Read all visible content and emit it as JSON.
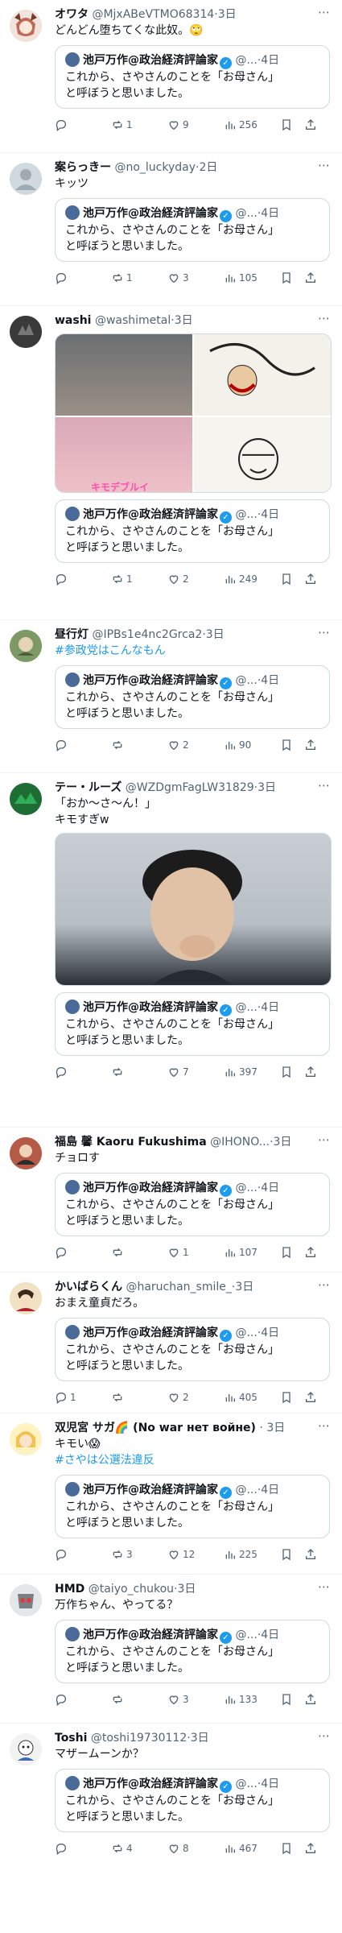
{
  "quoted": {
    "name": "池戸万作@政治経済評論家",
    "handle": "@...",
    "time": "4日",
    "text_line1": "これから、さやさんのことを「お母さん」",
    "text_line2": "と呼ぼうと思いました。"
  },
  "tweets": [
    {
      "name": "オワタ",
      "handle": "@MjxABeVTMO68314",
      "time": "3日",
      "line1": "どんどん堕ちてくな此奴。🙄",
      "line2": "",
      "replies": "",
      "retweets": "1",
      "likes": "9",
      "views": "256"
    },
    {
      "name": "案らっきー",
      "handle": "@no_luckyday",
      "time": "2日",
      "line1": "キッツ",
      "line2": "",
      "replies": "",
      "retweets": "1",
      "likes": "3",
      "views": "105"
    },
    {
      "name": "washi",
      "handle": "@washimetal",
      "time": "3日",
      "line1": "",
      "line2": "",
      "replies": "",
      "retweets": "1",
      "likes": "2",
      "views": "249",
      "media_caption": "キモデブルイ"
    },
    {
      "name": "昼行灯",
      "handle": "@IPBs1e4nc2Grca2",
      "time": "3日",
      "line1": "",
      "line1_tag": "#参政党はこんなもん",
      "line2": "",
      "replies": "",
      "retweets": "",
      "likes": "2",
      "views": "90"
    },
    {
      "name": "テー・ルーズ",
      "handle": "@WZDgmFagLW31829",
      "time": "3日",
      "line1": "「おか〜さ〜ん！」",
      "line2": "キモすぎw",
      "replies": "",
      "retweets": "",
      "likes": "7",
      "views": "397"
    },
    {
      "name": "福島 馨 Kaoru Fukushima",
      "handle": "@IHONO...",
      "time": "3日",
      "line1": "チョロす",
      "line2": "",
      "replies": "",
      "retweets": "",
      "likes": "1",
      "views": "107"
    },
    {
      "name": "かいばらくん",
      "handle": "@haruchan_smile_",
      "time": "3日",
      "line1": "おまえ童貞だろ。",
      "line2": "",
      "replies": "1",
      "retweets": "",
      "likes": "2",
      "views": "405"
    },
    {
      "name": "双児宮 サガ🌈 (No war нет войне)",
      "handle": "",
      "time": "3日",
      "line1": "キモい😱",
      "line2": "",
      "line2_tag": "#さやは公選法違反",
      "replies": "",
      "retweets": "3",
      "likes": "12",
      "views": "225"
    },
    {
      "name": "HMD",
      "handle": "@taiyo_chukou",
      "time": "3日",
      "line1": "万作ちゃん、やってる？",
      "line2": "",
      "replies": "",
      "retweets": "",
      "likes": "3",
      "views": "133"
    },
    {
      "name": "Toshi",
      "handle": "@toshi19730112",
      "time": "3日",
      "line1": "マザームーンか？",
      "line2": "",
      "replies": "",
      "retweets": "4",
      "likes": "8",
      "views": "467"
    }
  ],
  "icons": {
    "reply": "reply-icon",
    "retweet": "retweet-icon",
    "like": "heart-icon",
    "views": "views-icon",
    "bookmark": "bookmark-icon",
    "share": "share-icon",
    "more": "more-icon",
    "verified": "verified-badge-icon"
  },
  "colors": {
    "link": "#1d9bf0",
    "muted": "#536471",
    "border": "#cfd9de"
  }
}
